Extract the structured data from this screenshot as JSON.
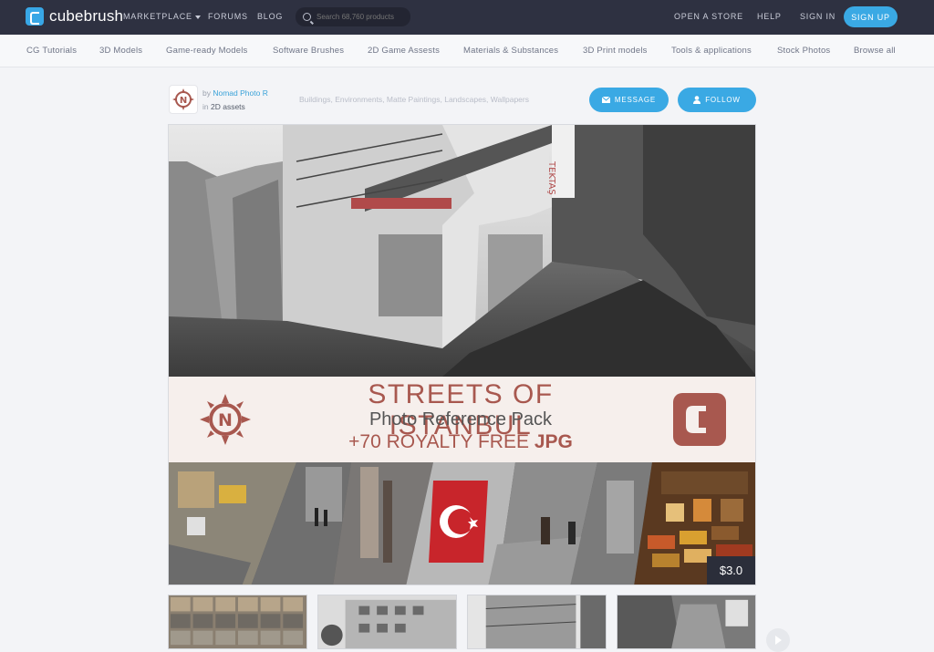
{
  "header": {
    "brand": "cubebrush",
    "nav": {
      "marketplace": "MARKETPLACE",
      "forums": "FORUMS",
      "blog": "BLOG"
    },
    "search_placeholder": "Search 68,760 products",
    "right": {
      "open_store": "OPEN A STORE",
      "help": "HELP",
      "sign_in": "SIGN IN",
      "sign_up": "SIGN UP"
    }
  },
  "categories": [
    "CG Tutorials",
    "3D Models",
    "Game-ready Models",
    "Software Brushes",
    "2D Game Assests",
    "Materials & Substances",
    "3D Print models",
    "Tools & applications",
    "Stock Photos",
    "Browse all"
  ],
  "product": {
    "by_label": "by",
    "author": "Nomad Photo R",
    "in_label": "in",
    "category": "2D assets",
    "tags": "Buildings, Environments, Matte Paintings, Landscapes, Wallpapers",
    "message_label": "MESSAGE",
    "follow_label": "FOLLOW",
    "banner": {
      "title": "STREETS OF ISTANBUL",
      "subtitle": "Photo Reference Pack",
      "line3_prefix": "+70 ROYALTY FREE ",
      "line3_suffix": "JPG"
    },
    "price": "$3.0"
  },
  "colors": {
    "accent": "#3aa9e4",
    "nav_bg": "#2e3141",
    "banner_text": "#a8584f"
  },
  "icons": {
    "avatar_logo": "compass-n-logo",
    "message": "envelope-icon",
    "follow": "user-icon",
    "search": "search-icon"
  }
}
